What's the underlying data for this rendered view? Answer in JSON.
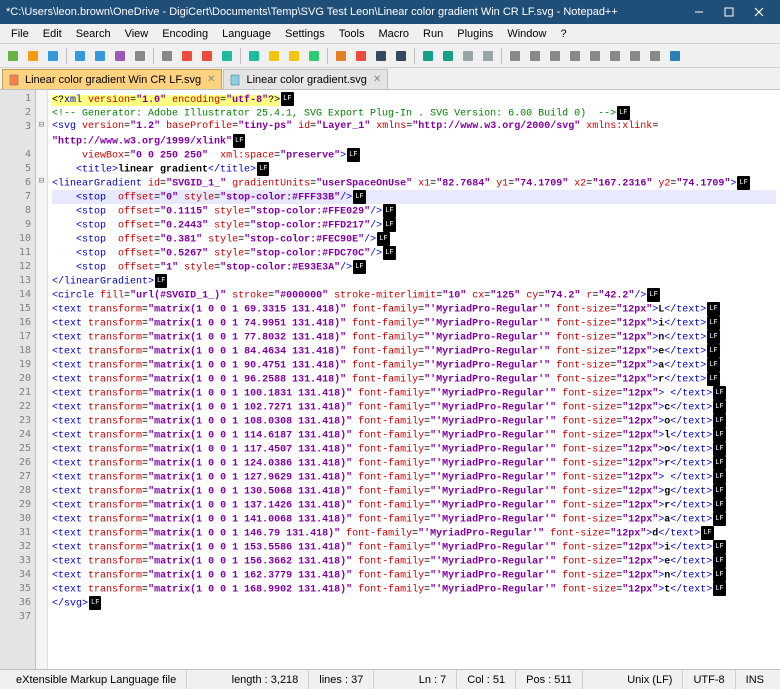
{
  "window": {
    "title": "*C:\\Users\\leon.brown\\OneDrive - DigiCert\\Documents\\Temp\\SVG Test Leon\\Linear color gradient Win CR LF.svg - Notepad++"
  },
  "menu": {
    "items": [
      "File",
      "Edit",
      "Search",
      "View",
      "Encoding",
      "Language",
      "Settings",
      "Tools",
      "Macro",
      "Run",
      "Plugins",
      "Window",
      "?"
    ]
  },
  "tabs": [
    {
      "label": "Linear color gradient Win CR LF.svg",
      "active": true
    },
    {
      "label": "Linear color gradient.svg",
      "active": false
    }
  ],
  "status": {
    "filetype": "eXtensible Markup Language file",
    "length": "length : 3,218",
    "lines": "lines : 37",
    "ln": "Ln : 7",
    "col": "Col : 51",
    "pos": "Pos : 511",
    "eol": "Unix (LF)",
    "enc": "UTF-8",
    "mode": "INS"
  },
  "code": {
    "total_lines": 37,
    "highlight_line": 7,
    "fold_marks": {
      "3": "⊟",
      "6": "⊟"
    },
    "lines": [
      "<span class='xmldecl'>&lt;?<span class='tag'>xml</span> <span class='attr'>version</span>=<span class='val'>\"1.0\"</span> <span class='attr'>encoding</span>=<span class='val'>\"utf-8\"</span>?&gt;</span><span class='lfmark'>LF</span>",
      "<span class='cmt'>&lt;!-- Generator: Adobe Illustrator 25.4.1, SVG Export Plug-In . SVG Version: 6.00 Build 0)  --&gt;</span><span class='lfmark'>LF</span>",
      "<span class='tag'>&lt;svg</span> <span class='attr'>version</span>=<span class='val'>\"1.2\"</span> <span class='attr'>baseProfile</span>=<span class='val'>\"tiny-ps\"</span> <span class='attr'>id</span>=<span class='val'>\"Layer_1\"</span> <span class='attr'>xmlns</span>=<span class='val'>\"http://www.w3.org/2000/svg\"</span> <span class='attr'>xmlns:xlink</span>=",
      "<span class='val'>\"http://www.w3.org/1999/xlink\"</span><span class='lfmark'>LF</span>",
      "     <span class='attr'>viewBox</span>=<span class='val'>\"0 0 250 250\"</span>  <span class='attr'>xml:space</span>=<span class='val'>\"preserve\"</span><span class='tag'>&gt;</span><span class='lfmark'>LF</span>",
      "    <span class='tag'>&lt;title&gt;</span><span class='txt'>linear gradient</span><span class='tag'>&lt;/title&gt;</span><span class='lfmark'>LF</span>",
      "<span class='tag'>&lt;linearGradient</span> <span class='attr'>id</span>=<span class='val'>\"SVGID_1_\"</span> <span class='attr'>gradientUnits</span>=<span class='val'>\"userSpaceOnUse\"</span> <span class='attr'>x1</span>=<span class='val'>\"82.7684\"</span> <span class='attr'>y1</span>=<span class='val'>\"74.1709\"</span> <span class='attr'>x2</span>=<span class='val'>\"167.2316\"</span> <span class='attr'>y2</span>=<span class='val'>\"74.1709\"</span><span class='tag'>&gt;</span><span class='lfmark'>LF</span>",
      "    <span class='tag'>&lt;stop</span>  <span class='attr'>offset</span>=<span class='val'>\"0\"</span> <span class='attr'>style</span>=<span class='val'>\"stop-color:#FFF33B\"</span><span class='tag'>/&gt;</span><span class='lfmark'>LF</span>",
      "    <span class='tag'>&lt;stop</span>  <span class='attr'>offset</span>=<span class='val'>\"0.1115\"</span> <span class='attr'>style</span>=<span class='val'>\"stop-color:#FFE029\"</span><span class='tag'>/&gt;</span><span class='lfmark'>LF</span>",
      "    <span class='tag'>&lt;stop</span>  <span class='attr'>offset</span>=<span class='val'>\"0.2443\"</span> <span class='attr'>style</span>=<span class='val'>\"stop-color:#FFD217\"</span><span class='tag'>/&gt;</span><span class='lfmark'>LF</span>",
      "    <span class='tag'>&lt;stop</span>  <span class='attr'>offset</span>=<span class='val'>\"0.381\"</span> <span class='attr'>style</span>=<span class='val'>\"stop-color:#FEC90E\"</span><span class='tag'>/&gt;</span><span class='lfmark'>LF</span>",
      "    <span class='tag'>&lt;stop</span>  <span class='attr'>offset</span>=<span class='val'>\"0.5267\"</span> <span class='attr'>style</span>=<span class='val'>\"stop-color:#FDC70C\"</span><span class='tag'>/&gt;</span><span class='lfmark'>LF</span>",
      "    <span class='tag'>&lt;stop</span>  <span class='attr'>offset</span>=<span class='val'>\"1\"</span> <span class='attr'>style</span>=<span class='val'>\"stop-color:#E93E3A\"</span><span class='tag'>/&gt;</span><span class='lfmark'>LF</span>",
      "<span class='tag'>&lt;/linearGradient&gt;</span><span class='lfmark'>LF</span>",
      "<span class='tag'>&lt;circle</span> <span class='attr'>fill</span>=<span class='val'>\"url(#SVGID_1_)\"</span> <span class='attr'>stroke</span>=<span class='val'>\"#000000\"</span> <span class='attr'>stroke-miterlimit</span>=<span class='val'>\"10\"</span> <span class='attr'>cx</span>=<span class='val'>\"125\"</span> <span class='attr'>cy</span>=<span class='val'>\"74.2\"</span> <span class='attr'>r</span>=<span class='val'>\"42.2\"</span><span class='tag'>/&gt;</span><span class='lfmark'>LF</span>",
      "<span class='tag'>&lt;text</span> <span class='attr'>transform</span>=<span class='val'>\"matrix(1 0 0 1 69.3315 131.418)\"</span> <span class='attr'>font-family</span>=<span class='val'>\"'MyriadPro-Regular'\"</span> <span class='attr'>font-size</span>=<span class='val'>\"12px\"</span><span class='tag'>&gt;</span><span class='txt'>L</span><span class='tag'>&lt;/text&gt;</span><span class='lfmark'>LF</span>",
      "<span class='tag'>&lt;text</span> <span class='attr'>transform</span>=<span class='val'>\"matrix(1 0 0 1 74.9951 131.418)\"</span> <span class='attr'>font-family</span>=<span class='val'>\"'MyriadPro-Regular'\"</span> <span class='attr'>font-size</span>=<span class='val'>\"12px\"</span><span class='tag'>&gt;</span><span class='txt'>i</span><span class='tag'>&lt;/text&gt;</span><span class='lfmark'>LF</span>",
      "<span class='tag'>&lt;text</span> <span class='attr'>transform</span>=<span class='val'>\"matrix(1 0 0 1 77.8032 131.418)\"</span> <span class='attr'>font-family</span>=<span class='val'>\"'MyriadPro-Regular'\"</span> <span class='attr'>font-size</span>=<span class='val'>\"12px\"</span><span class='tag'>&gt;</span><span class='txt'>n</span><span class='tag'>&lt;/text&gt;</span><span class='lfmark'>LF</span>",
      "<span class='tag'>&lt;text</span> <span class='attr'>transform</span>=<span class='val'>\"matrix(1 0 0 1 84.4634 131.418)\"</span> <span class='attr'>font-family</span>=<span class='val'>\"'MyriadPro-Regular'\"</span> <span class='attr'>font-size</span>=<span class='val'>\"12px\"</span><span class='tag'>&gt;</span><span class='txt'>e</span><span class='tag'>&lt;/text&gt;</span><span class='lfmark'>LF</span>",
      "<span class='tag'>&lt;text</span> <span class='attr'>transform</span>=<span class='val'>\"matrix(1 0 0 1 90.4751 131.418)\"</span> <span class='attr'>font-family</span>=<span class='val'>\"'MyriadPro-Regular'\"</span> <span class='attr'>font-size</span>=<span class='val'>\"12px\"</span><span class='tag'>&gt;</span><span class='txt'>a</span><span class='tag'>&lt;/text&gt;</span><span class='lfmark'>LF</span>",
      "<span class='tag'>&lt;text</span> <span class='attr'>transform</span>=<span class='val'>\"matrix(1 0 0 1 96.2588 131.418)\"</span> <span class='attr'>font-family</span>=<span class='val'>\"'MyriadPro-Regular'\"</span> <span class='attr'>font-size</span>=<span class='val'>\"12px\"</span><span class='tag'>&gt;</span><span class='txt'>r</span><span class='tag'>&lt;/text&gt;</span><span class='lfmark'>LF</span>",
      "<span class='tag'>&lt;text</span> <span class='attr'>transform</span>=<span class='val'>\"matrix(1 0 0 1 100.1831 131.418)\"</span> <span class='attr'>font-family</span>=<span class='val'>\"'MyriadPro-Regular'\"</span> <span class='attr'>font-size</span>=<span class='val'>\"12px\"</span><span class='tag'>&gt;</span><span class='txt'> </span><span class='tag'>&lt;/text&gt;</span><span class='lfmark'>LF</span>",
      "<span class='tag'>&lt;text</span> <span class='attr'>transform</span>=<span class='val'>\"matrix(1 0 0 1 102.7271 131.418)\"</span> <span class='attr'>font-family</span>=<span class='val'>\"'MyriadPro-Regular'\"</span> <span class='attr'>font-size</span>=<span class='val'>\"12px\"</span><span class='tag'>&gt;</span><span class='txt'>c</span><span class='tag'>&lt;/text&gt;</span><span class='lfmark'>LF</span>",
      "<span class='tag'>&lt;text</span> <span class='attr'>transform</span>=<span class='val'>\"matrix(1 0 0 1 108.0308 131.418)\"</span> <span class='attr'>font-family</span>=<span class='val'>\"'MyriadPro-Regular'\"</span> <span class='attr'>font-size</span>=<span class='val'>\"12px\"</span><span class='tag'>&gt;</span><span class='txt'>o</span><span class='tag'>&lt;/text&gt;</span><span class='lfmark'>LF</span>",
      "<span class='tag'>&lt;text</span> <span class='attr'>transform</span>=<span class='val'>\"matrix(1 0 0 1 114.6187 131.418)\"</span> <span class='attr'>font-family</span>=<span class='val'>\"'MyriadPro-Regular'\"</span> <span class='attr'>font-size</span>=<span class='val'>\"12px\"</span><span class='tag'>&gt;</span><span class='txt'>l</span><span class='tag'>&lt;/text&gt;</span><span class='lfmark'>LF</span>",
      "<span class='tag'>&lt;text</span> <span class='attr'>transform</span>=<span class='val'>\"matrix(1 0 0 1 117.4507 131.418)\"</span> <span class='attr'>font-family</span>=<span class='val'>\"'MyriadPro-Regular'\"</span> <span class='attr'>font-size</span>=<span class='val'>\"12px\"</span><span class='tag'>&gt;</span><span class='txt'>o</span><span class='tag'>&lt;/text&gt;</span><span class='lfmark'>LF</span>",
      "<span class='tag'>&lt;text</span> <span class='attr'>transform</span>=<span class='val'>\"matrix(1 0 0 1 124.0386 131.418)\"</span> <span class='attr'>font-family</span>=<span class='val'>\"'MyriadPro-Regular'\"</span> <span class='attr'>font-size</span>=<span class='val'>\"12px\"</span><span class='tag'>&gt;</span><span class='txt'>r</span><span class='tag'>&lt;/text&gt;</span><span class='lfmark'>LF</span>",
      "<span class='tag'>&lt;text</span> <span class='attr'>transform</span>=<span class='val'>\"matrix(1 0 0 1 127.9629 131.418)\"</span> <span class='attr'>font-family</span>=<span class='val'>\"'MyriadPro-Regular'\"</span> <span class='attr'>font-size</span>=<span class='val'>\"12px\"</span><span class='tag'>&gt;</span><span class='txt'> </span><span class='tag'>&lt;/text&gt;</span><span class='lfmark'>LF</span>",
      "<span class='tag'>&lt;text</span> <span class='attr'>transform</span>=<span class='val'>\"matrix(1 0 0 1 130.5068 131.418)\"</span> <span class='attr'>font-family</span>=<span class='val'>\"'MyriadPro-Regular'\"</span> <span class='attr'>font-size</span>=<span class='val'>\"12px\"</span><span class='tag'>&gt;</span><span class='txt'>g</span><span class='tag'>&lt;/text&gt;</span><span class='lfmark'>LF</span>",
      "<span class='tag'>&lt;text</span> <span class='attr'>transform</span>=<span class='val'>\"matrix(1 0 0 1 137.1426 131.418)\"</span> <span class='attr'>font-family</span>=<span class='val'>\"'MyriadPro-Regular'\"</span> <span class='attr'>font-size</span>=<span class='val'>\"12px\"</span><span class='tag'>&gt;</span><span class='txt'>r</span><span class='tag'>&lt;/text&gt;</span><span class='lfmark'>LF</span>",
      "<span class='tag'>&lt;text</span> <span class='attr'>transform</span>=<span class='val'>\"matrix(1 0 0 1 141.0068 131.418)\"</span> <span class='attr'>font-family</span>=<span class='val'>\"'MyriadPro-Regular'\"</span> <span class='attr'>font-size</span>=<span class='val'>\"12px\"</span><span class='tag'>&gt;</span><span class='txt'>a</span><span class='tag'>&lt;/text&gt;</span><span class='lfmark'>LF</span>",
      "<span class='tag'>&lt;text</span> <span class='attr'>transform</span>=<span class='val'>\"matrix(1 0 0 1 146.79 131.418)\"</span> <span class='attr'>font-family</span>=<span class='val'>\"'MyriadPro-Regular'\"</span> <span class='attr'>font-size</span>=<span class='val'>\"12px\"</span><span class='tag'>&gt;</span><span class='txt'>d</span><span class='tag'>&lt;/text&gt;</span><span class='lfmark'>LF</span>",
      "<span class='tag'>&lt;text</span> <span class='attr'>transform</span>=<span class='val'>\"matrix(1 0 0 1 153.5586 131.418)\"</span> <span class='attr'>font-family</span>=<span class='val'>\"'MyriadPro-Regular'\"</span> <span class='attr'>font-size</span>=<span class='val'>\"12px\"</span><span class='tag'>&gt;</span><span class='txt'>i</span><span class='tag'>&lt;/text&gt;</span><span class='lfmark'>LF</span>",
      "<span class='tag'>&lt;text</span> <span class='attr'>transform</span>=<span class='val'>\"matrix(1 0 0 1 156.3662 131.418)\"</span> <span class='attr'>font-family</span>=<span class='val'>\"'MyriadPro-Regular'\"</span> <span class='attr'>font-size</span>=<span class='val'>\"12px\"</span><span class='tag'>&gt;</span><span class='txt'>e</span><span class='tag'>&lt;/text&gt;</span><span class='lfmark'>LF</span>",
      "<span class='tag'>&lt;text</span> <span class='attr'>transform</span>=<span class='val'>\"matrix(1 0 0 1 162.3779 131.418)\"</span> <span class='attr'>font-family</span>=<span class='val'>\"'MyriadPro-Regular'\"</span> <span class='attr'>font-size</span>=<span class='val'>\"12px\"</span><span class='tag'>&gt;</span><span class='txt'>n</span><span class='tag'>&lt;/text&gt;</span><span class='lfmark'>LF</span>",
      "<span class='tag'>&lt;text</span> <span class='attr'>transform</span>=<span class='val'>\"matrix(1 0 0 1 168.9902 131.418)\"</span> <span class='attr'>font-family</span>=<span class='val'>\"'MyriadPro-Regular'\"</span> <span class='attr'>font-size</span>=<span class='val'>\"12px\"</span><span class='tag'>&gt;</span><span class='txt'>t</span><span class='tag'>&lt;/text&gt;</span><span class='lfmark'>LF</span>",
      "<span class='tag'>&lt;/svg&gt;</span><span class='lfmark'>LF</span>",
      ""
    ]
  }
}
